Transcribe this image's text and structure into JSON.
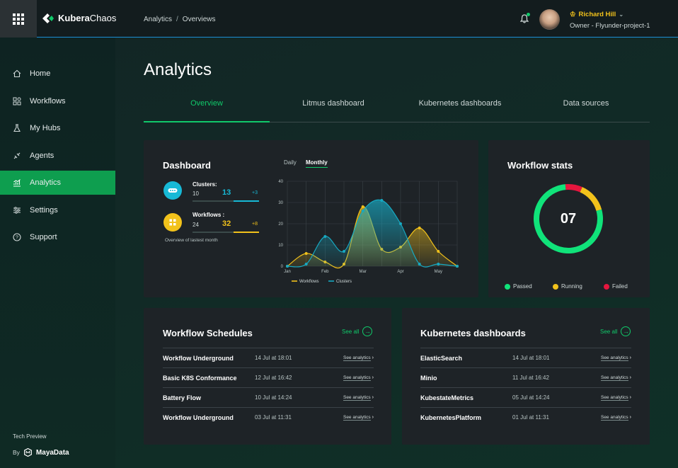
{
  "brand": {
    "name_bold": "Kubera",
    "name_light": "Chaos"
  },
  "breadcrumb": {
    "parent": "Analytics",
    "sep": "/",
    "current": "Overviews"
  },
  "user": {
    "name": "Richard Hill",
    "role": "Owner - Flyunder-project-1"
  },
  "sidebar": {
    "items": [
      {
        "label": "Home",
        "icon": "home-icon"
      },
      {
        "label": "Workflows",
        "icon": "workflows-icon"
      },
      {
        "label": "My Hubs",
        "icon": "hub-icon"
      },
      {
        "label": "Agents",
        "icon": "agents-icon"
      },
      {
        "label": "Analytics",
        "icon": "analytics-icon",
        "active": true
      },
      {
        "label": "Settings",
        "icon": "settings-icon"
      },
      {
        "label": "Support",
        "icon": "support-icon"
      }
    ],
    "footer_tech": "Tech Preview",
    "footer_by": "By",
    "footer_brand": "MayaData"
  },
  "page": {
    "title": "Analytics"
  },
  "tabs": [
    "Overview",
    "Litmus dashboard",
    "Kubernetes dashboards",
    "Data sources"
  ],
  "dashboard": {
    "title": "Dashboard",
    "clusters": {
      "label": "Clusters:",
      "prev": "10",
      "current": "13",
      "delta": "+3"
    },
    "workflows": {
      "label": "Workflows :",
      "prev": "24",
      "current": "32",
      "delta": "+8"
    },
    "note": "Overview of lastest month",
    "toggle": {
      "daily": "Daily",
      "monthly": "Monthly"
    }
  },
  "chart_data": {
    "type": "area",
    "x_ticks": [
      "Jan",
      "Feb",
      "Mar",
      "Apr",
      "May"
    ],
    "y_ticks": [
      "0",
      "10",
      "20",
      "30",
      "40"
    ],
    "ylim": [
      0,
      40
    ],
    "series": [
      {
        "name": "Workflows",
        "color": "#f2c21b",
        "x": [
          0,
          0.5,
          1,
          1.5,
          2,
          2.5,
          3,
          3.5,
          4,
          4.5
        ],
        "values": [
          0,
          6,
          2,
          1,
          28,
          8,
          9,
          18,
          7,
          0
        ]
      },
      {
        "name": "Clusters",
        "color": "#17a9c2",
        "x": [
          0,
          0.5,
          1,
          1.5,
          2,
          2.5,
          3,
          3.5,
          4,
          4.5
        ],
        "values": [
          0,
          1,
          14,
          7,
          26,
          31,
          20,
          1,
          1,
          0
        ]
      }
    ]
  },
  "workflow_stats": {
    "title": "Workflow stats",
    "count": "07",
    "ring": {
      "passed": 0.78,
      "running": 0.14,
      "failed": 0.08
    },
    "legend": [
      {
        "label": "Passed",
        "color": "#10e37a"
      },
      {
        "label": "Running",
        "color": "#f2c21b"
      },
      {
        "label": "Failed",
        "color": "#e5163e"
      }
    ]
  },
  "schedules": {
    "title": "Workflow Schedules",
    "see_all": "See all",
    "rows": [
      {
        "name": "Workflow Underground",
        "time": "14 Jul at 18:01",
        "action": "See analytics"
      },
      {
        "name": "Basic K8S Conformance",
        "time": "12 Jul at 16:42",
        "action": "See analytics"
      },
      {
        "name": "Battery Flow",
        "time": "10 Jul at 14:24",
        "action": "See analytics"
      },
      {
        "name": "Workflow Underground",
        "time": "03 Jul at 11:31",
        "action": "See analytics"
      }
    ]
  },
  "k8s": {
    "title": "Kubernetes dashboards",
    "see_all": "See all",
    "rows": [
      {
        "name": "ElasticSearch",
        "time": "14 Jul at 18:01",
        "action": "See analytics"
      },
      {
        "name": "Minio",
        "time": "11 Jul at 16:42",
        "action": "See analytics"
      },
      {
        "name": "KubestateMetrics",
        "time": "05 Jul at 14:24",
        "action": "See analytics"
      },
      {
        "name": "KubernetesPlatform",
        "time": "01 Jul at 11:31",
        "action": "See analytics"
      }
    ]
  },
  "colors": {
    "accent": "#10c96a",
    "yellow": "#f2c21b",
    "cyan": "#17a9c2",
    "red": "#e5163e"
  }
}
